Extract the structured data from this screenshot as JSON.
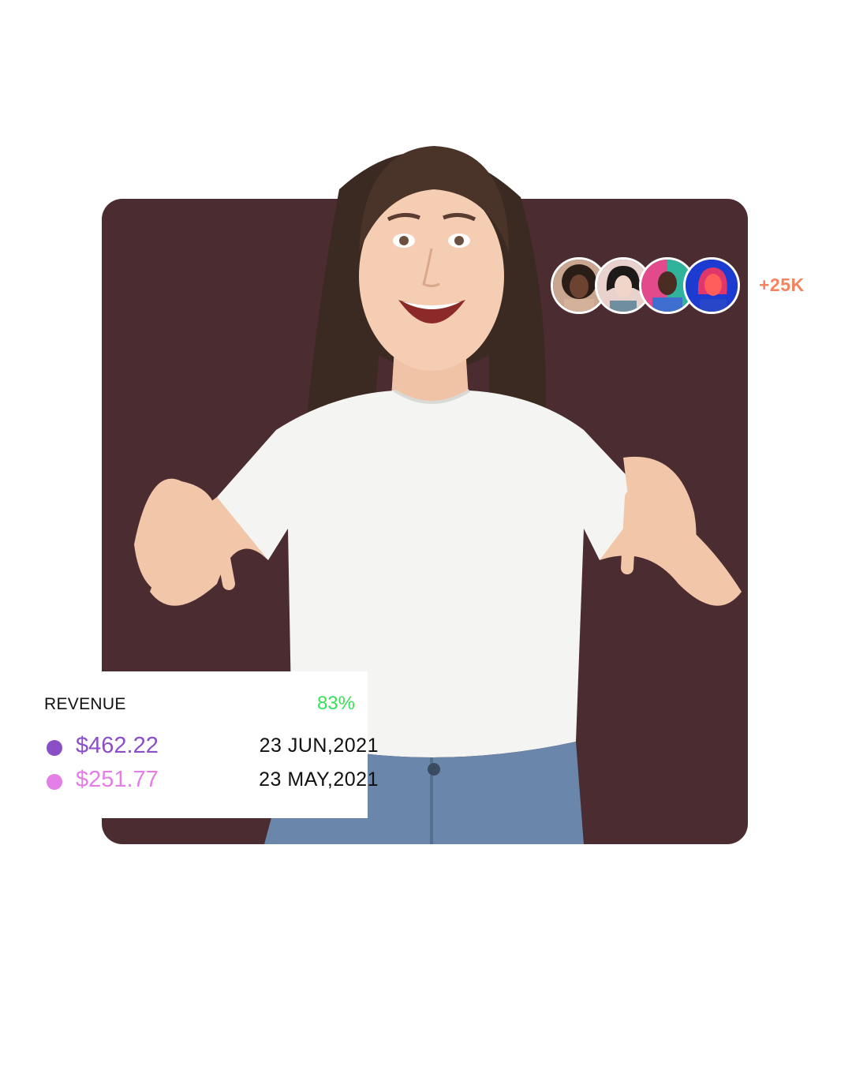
{
  "colors": {
    "card_background": "#4a2c31",
    "count_color": "#f4845f",
    "percent_color": "#39e05a",
    "series_primary": "#8a4fc6",
    "series_secondary": "#e27ee6"
  },
  "audience": {
    "avatars": [
      "avatar-woman-curly-hair",
      "avatar-woman-dark-hair",
      "avatar-man-colorful",
      "avatar-woman-neon-light"
    ],
    "count_label": "+25K"
  },
  "revenue": {
    "title": "REVENUE",
    "percent": "83%",
    "entries": [
      {
        "amount": "$462.22",
        "date": "23 JUN,2021"
      },
      {
        "amount": "$251.77",
        "date": "23 MAY,2021"
      }
    ]
  }
}
